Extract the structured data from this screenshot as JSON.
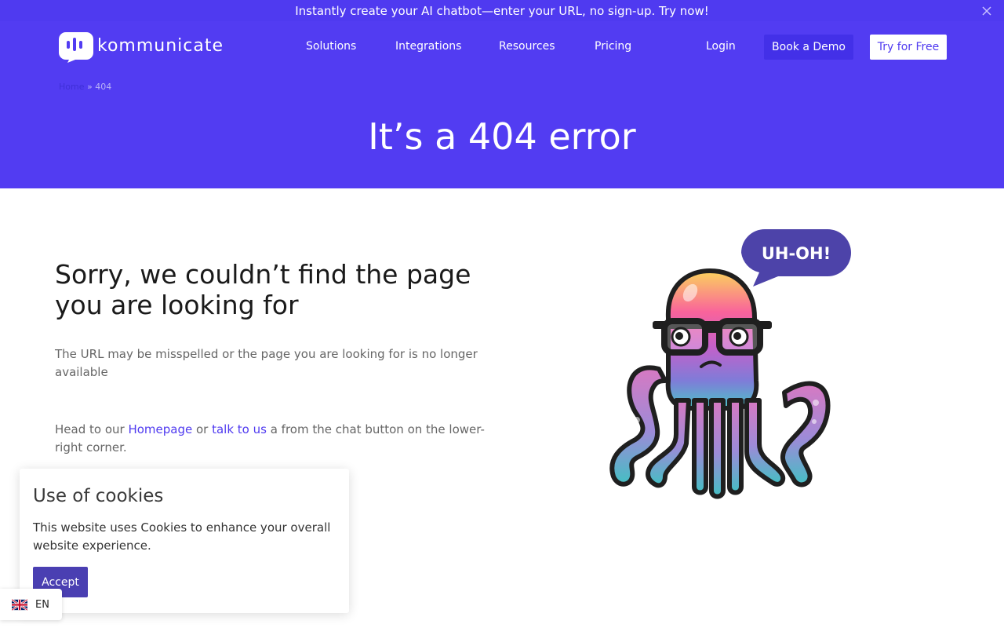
{
  "announcement": {
    "text": "Instantly create your AI chatbot—enter your URL, no sign-up. Try now!"
  },
  "header": {
    "logo_text": "kommunicate",
    "nav": [
      "Solutions",
      "Integrations",
      "Resources",
      "Pricing"
    ],
    "login": "Login",
    "book_demo": "Book a Demo",
    "try_free": "Try for Free"
  },
  "breadcrumb": {
    "home": "Home",
    "separator": "»",
    "current": "404"
  },
  "hero": {
    "title": "It’s a 404 error"
  },
  "content": {
    "heading": "Sorry, we couldn’t find the page you are looking for",
    "description": "The URL may be misspelled or the page you are looking for is no longer available",
    "cta_prefix": "Head to our ",
    "homepage_link": "Homepage",
    "cta_or": " or ",
    "talk_link": "talk to us",
    "cta_suffix": " a from the chat button on the lower-right corner."
  },
  "illustration": {
    "speech_bubble": "UH-OH!"
  },
  "cookie_banner": {
    "title": "Use of cookies",
    "text": "This website uses Cookies to enhance your overall website experience.",
    "accept": "Accept"
  },
  "language": {
    "label": "EN"
  },
  "colors": {
    "brand": "#523cf2",
    "link": "#4f3af0",
    "accept_button": "#4a3fb2"
  }
}
